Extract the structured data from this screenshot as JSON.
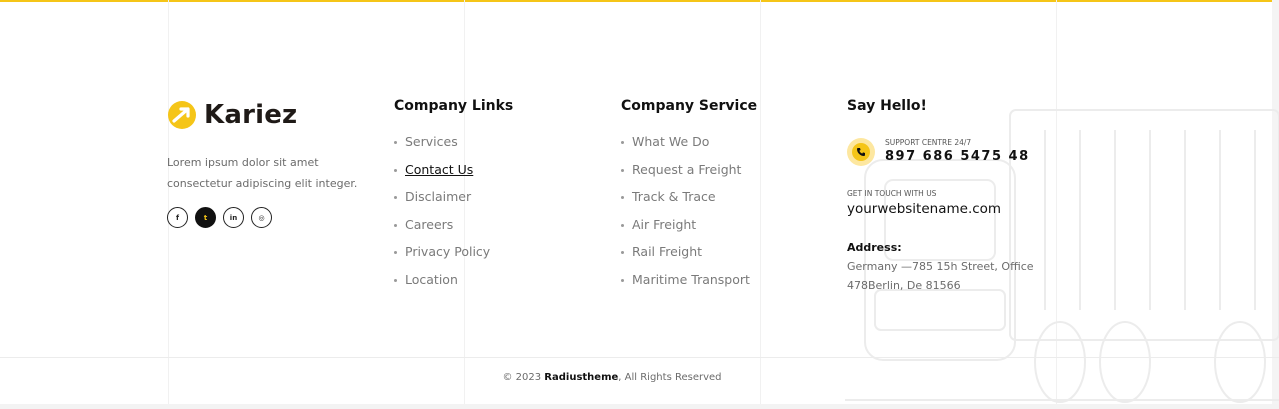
{
  "brand": {
    "name": "Kariez",
    "accent_color": "#f5c518",
    "logo_icon": "arrow-swoosh-icon"
  },
  "about": {
    "text": "Lorem ipsum dolor sit amet consectetur adipiscing elit integer."
  },
  "socials": [
    {
      "icon": "facebook-icon",
      "glyph": "f"
    },
    {
      "icon": "twitter-icon",
      "glyph": "t"
    },
    {
      "icon": "linkedin-icon",
      "glyph": "in"
    },
    {
      "icon": "instagram-icon",
      "glyph": "◎"
    }
  ],
  "company_links": {
    "title": "Company Links",
    "items": [
      "Services",
      "Contact Us",
      "Disclaimer",
      "Careers",
      "Privacy Policy",
      "Location"
    ]
  },
  "company_service": {
    "title": "Company Service",
    "items": [
      "What We Do",
      "Request a Freight",
      "Track & Trace",
      "Air Freight",
      "Rail Freight",
      "Maritime Transport"
    ]
  },
  "say_hello": {
    "title": "Say Hello!",
    "support_label": "SUPPORT CENTRE 24/7",
    "support_number": "897 686 5475 48",
    "touch_label": "GET IN TOUCH WITH US",
    "website": "yourwebsitename.com",
    "address_label": "Address:",
    "address_text": "Germany —785 15h Street, Office 478Berlin, De 81566"
  },
  "footer": {
    "copyright_prefix": "© 2023 ",
    "copyright_brand": "Radiustheme",
    "copyright_suffix": ", All Rights Reserved"
  }
}
